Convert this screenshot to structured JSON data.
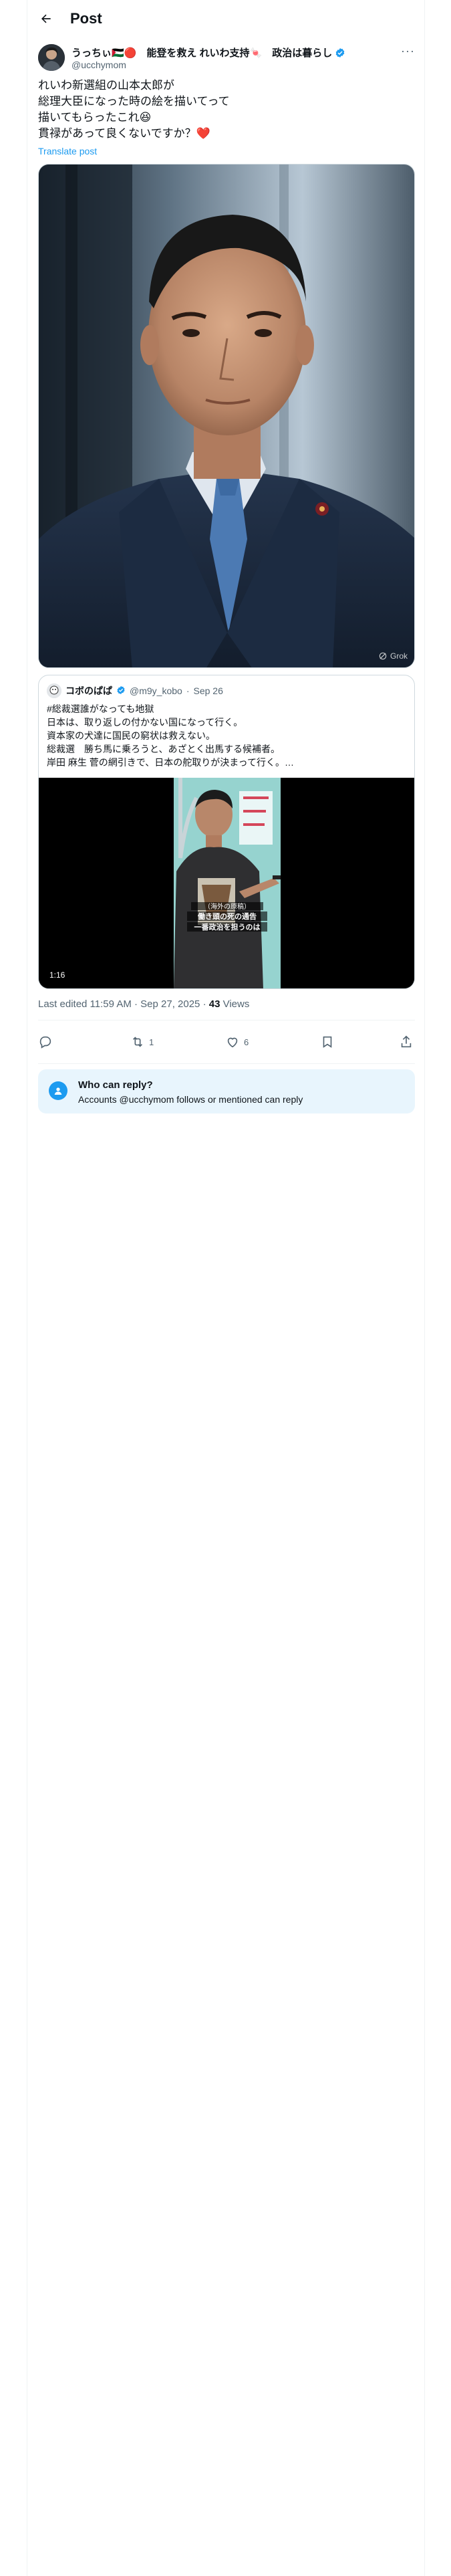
{
  "header": {
    "title": "Post",
    "back_icon": "arrow-left-icon"
  },
  "author": {
    "name": "うっちぃ🇵🇸🔴　能登を救え れいわ支持🍬　政治は暮らし",
    "handle": "@ucchymom",
    "verified": true
  },
  "post": {
    "lines": [
      "れいわ新選組の山本太郎が",
      "総理大臣になった時の絵を描いてって",
      "描いてもらったこれ😆",
      "貫禄があって良くないですか？❤️"
    ],
    "translate_label": "Translate post",
    "image_badge": "Grok"
  },
  "quote": {
    "name": "コボのぱぱ",
    "handle": "@m9y_kobo",
    "date": "Sep 26",
    "lines": [
      "#総裁選誰がなっても地獄",
      "日本は、取り返しの付かない国になって行く。",
      "資本家の犬達に国民の窮状は救えない。",
      "総裁選　勝ち馬に乗ろうと、あざとく出馬する候補者。",
      "岸田 麻生 菅の網引きで、日本の舵取りが決まって行く。…"
    ],
    "video_caption_1": "（海外の原稿）",
    "video_caption_2": "働き頭の死の通告",
    "video_caption_3": "一番政治を担うのは",
    "video_duration": "1:16"
  },
  "meta": {
    "edited": "Last edited 11:59 AM · Sep 27, 2025 · ",
    "views_count": "43",
    "views_label": " Views"
  },
  "actions": {
    "reply_count": "",
    "repost_count": "1",
    "like_count": "6",
    "bookmark_count": "",
    "share_label": ""
  },
  "reply_settings": {
    "title": "Who can reply?",
    "subtitle": "Accounts @ucchymom follows or mentioned can reply"
  },
  "colors": {
    "accent": "#1d9bf0",
    "text": "#0f1419",
    "muted": "#536471",
    "reply_bg": "#e8f5fd"
  }
}
